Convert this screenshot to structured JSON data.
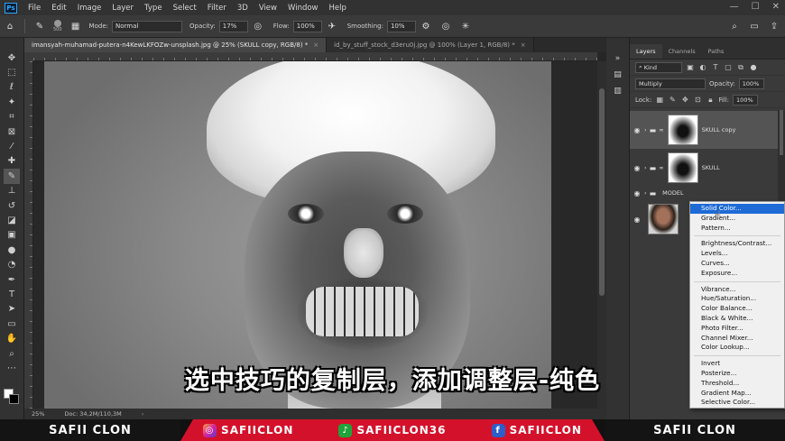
{
  "menubar": {
    "logo": "Ps",
    "items": [
      "File",
      "Edit",
      "Image",
      "Layer",
      "Type",
      "Select",
      "Filter",
      "3D",
      "View",
      "Window",
      "Help"
    ],
    "window_controls": [
      "—",
      "☐",
      "✕"
    ]
  },
  "options": {
    "brush_size": "500",
    "mode_label": "Mode:",
    "mode_value": "Normal",
    "opacity_label": "Opacity:",
    "opacity_value": "17%",
    "flow_label": "Flow:",
    "flow_value": "100%",
    "smoothing_label": "Smoothing:",
    "smoothing_value": "10%"
  },
  "doc_tabs": [
    {
      "label": "imansyah-muhamad-putera-n4KewLKFOZw-unsplash.jpg @ 25% (SKULL copy, RGB/8) *",
      "close": "×"
    },
    {
      "label": "id_by_stuff_stock_d3eru0j.jpg @ 100% (Layer 1, RGB/8) *",
      "close": "×"
    }
  ],
  "status": {
    "zoom": "25%",
    "doc": "Doc: 34,2M/110,3M"
  },
  "layers_panel": {
    "tabs": [
      "Layers",
      "Channels",
      "Paths"
    ],
    "kind_label": "Kind",
    "blend_mode": "Multiply",
    "opacity_label": "Opacity:",
    "opacity_value": "100%",
    "lock_label": "Lock:",
    "fill_label": "Fill:",
    "fill_value": "100%",
    "layers": [
      {
        "name": "SKULL copy"
      },
      {
        "name": "SKULL"
      },
      {
        "name": "MODEL"
      },
      {
        "name": ""
      }
    ]
  },
  "adjustment_menu": {
    "group1": [
      "Solid Color...",
      "Gradient...",
      "Pattern..."
    ],
    "group2": [
      "Brightness/Contrast...",
      "Levels...",
      "Curves...",
      "Exposure..."
    ],
    "group3": [
      "Vibrance...",
      "Hue/Saturation...",
      "Color Balance...",
      "Black & White...",
      "Photo Filter...",
      "Channel Mixer...",
      "Color Lookup..."
    ],
    "group4": [
      "Invert",
      "Posterize...",
      "Threshold...",
      "Gradient Map...",
      "Selective Color..."
    ]
  },
  "subtitle": "选中技巧的复制层，添加调整层-纯色",
  "banner": {
    "left": "SAFII CLON",
    "instagram": "SAFIICLON",
    "tiktok": "SAFIICLON36",
    "facebook": "SAFIICLON",
    "right": "SAFII CLON"
  },
  "colors": {
    "menu_highlight": "#1e6bd6",
    "banner_red": "#d4112b",
    "ps_blue": "#31a8ff"
  }
}
